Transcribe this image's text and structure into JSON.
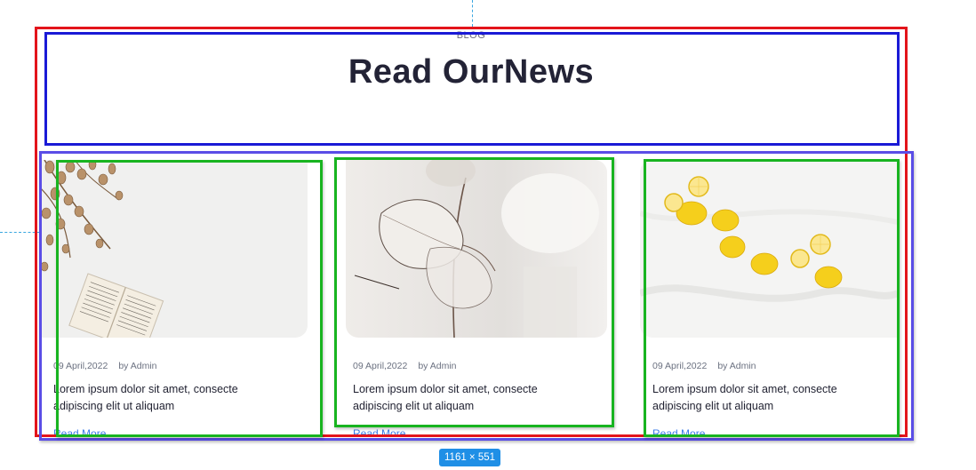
{
  "header": {
    "eyebrow": "BLOG",
    "title": "Read OurNews"
  },
  "posts": [
    {
      "date": "09 April,2022",
      "author": "by Admin",
      "excerpt_line1": "Lorem ipsum dolor sit amet, consecte",
      "excerpt_line2": "adipiscing elit ut aliquam",
      "link_label": "Read More",
      "image_subject": "eucalyptus-and-book"
    },
    {
      "date": "09 April,2022",
      "author": "by Admin",
      "excerpt_line1": "Lorem ipsum dolor sit amet, consecte",
      "excerpt_line2": "adipiscing elit ut aliquam",
      "link_label": "Read More",
      "image_subject": "dried-lunaria-plant"
    },
    {
      "date": "09 April,2022",
      "author": "by Admin",
      "excerpt_line1": "Lorem ipsum dolor sit amet, consecte",
      "excerpt_line2": "adipiscing elit ut aliquam",
      "link_label": "Read More",
      "image_subject": "lemons-on-white"
    }
  ],
  "overlay": {
    "size_badge": "1161 × 551",
    "colors": {
      "section_outline": "#e3141b",
      "header_outline": "#1a1ad6",
      "grid_outline": "#5a4de6",
      "card_outline": "#18b420",
      "guide": "#3aa7e0",
      "badge": "#1f8fe6"
    }
  },
  "theme": {
    "title_color": "#232336",
    "link_color": "#3b7be8",
    "meta_color": "#6b7180"
  }
}
